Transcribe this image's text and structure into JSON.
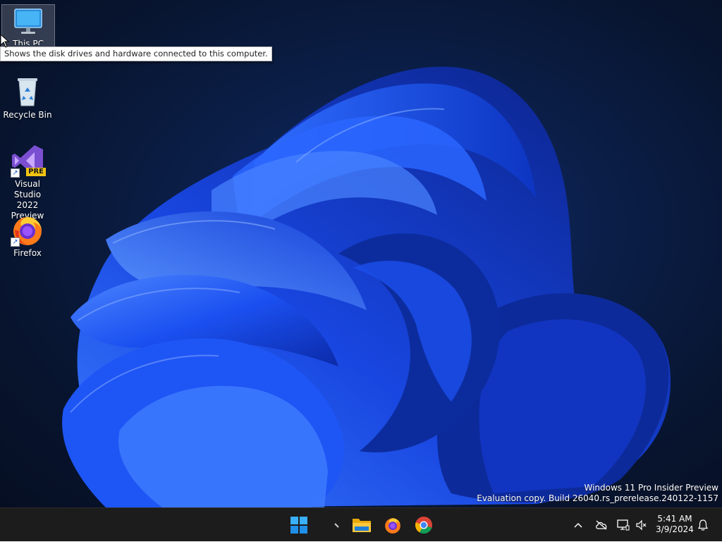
{
  "desktop": {
    "icons": [
      {
        "label": "This PC",
        "icon": "monitor-icon"
      },
      {
        "label": "Recycle Bin",
        "icon": "recycle-bin-icon"
      },
      {
        "label": "Visual Studio\n2022 Preview",
        "icon": "visual-studio-icon",
        "badge": "PRE"
      },
      {
        "label": "Firefox",
        "icon": "firefox-icon"
      }
    ],
    "tooltip": "Shows the disk drives and hardware connected to this computer.",
    "watermark": {
      "line1": "Windows 11 Pro Insider Preview",
      "line2": "Evaluation copy. Build 26040.rs_prerelease.240122-1157"
    }
  },
  "taskbar": {
    "pinned": [
      "start-icon",
      "file-explorer-icon",
      "firefox-icon",
      "chrome-icon"
    ],
    "tray": [
      "chevron-up-icon",
      "cloud-offline-icon",
      "network-icon",
      "volume-muted-icon",
      "notification-bell-icon"
    ],
    "clock": {
      "time": "5:41 AM",
      "date": "3/9/2024"
    }
  },
  "colors": {
    "accent": "#1a5cff",
    "taskbar": "#1c1c1c"
  }
}
